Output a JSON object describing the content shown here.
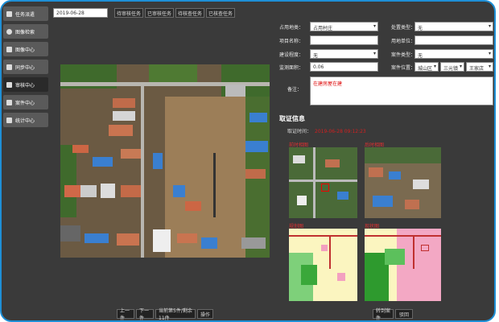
{
  "sidebar": {
    "items": [
      {
        "label": "任务派遣",
        "icon": "dispatch-icon"
      },
      {
        "label": "图像检索",
        "icon": "image-search-icon"
      },
      {
        "label": "图像中心",
        "icon": "image-center-icon"
      },
      {
        "label": "同步中心",
        "icon": "sync-icon"
      },
      {
        "label": "审核中心",
        "icon": "review-icon",
        "active": true
      },
      {
        "label": "案件中心",
        "icon": "case-grid-icon"
      },
      {
        "label": "统计中心",
        "icon": "stats-icon"
      }
    ]
  },
  "toolbar": {
    "date": "2019-06-28",
    "tabs": [
      "待审核任务",
      "已审核任务",
      "待核查任务",
      "已核查任务"
    ]
  },
  "form": {
    "land_use": {
      "label": "占用地类：",
      "value": "占用村庄"
    },
    "lease_type": {
      "label": "处置类型：",
      "value": "无"
    },
    "project_name": {
      "label": "项目名称：",
      "value": ""
    },
    "land_unit": {
      "label": "用地单位：",
      "value": ""
    },
    "build_stage": {
      "label": "建设程度：",
      "value": "无"
    },
    "case_type": {
      "label": "案件类型：",
      "value": "无"
    },
    "area": {
      "label": "监测面积：",
      "value": "0.06"
    },
    "location": {
      "label": "案件位置：",
      "district": "城山区",
      "town": "三元镇",
      "village": "王家店"
    },
    "remark": {
      "label": "备注：",
      "value": "在建房屋在建"
    }
  },
  "evidence": {
    "title": "取证信息",
    "time_label": "取证时间：",
    "time_value": "2019-06-28 09:12:23",
    "thumbs": [
      "前时相图",
      "后时相图",
      "规划图",
      "现状图"
    ]
  },
  "bottom": {
    "buttons": [
      "上一件",
      "下一件",
      "当前第5件/剩余11件",
      "操作"
    ],
    "right_buttons": [
      "转到案件",
      "驳回"
    ]
  },
  "colors": {
    "frame": "#1e8fd6",
    "panel": "#3a3a3a",
    "accent_red": "#d02020"
  }
}
